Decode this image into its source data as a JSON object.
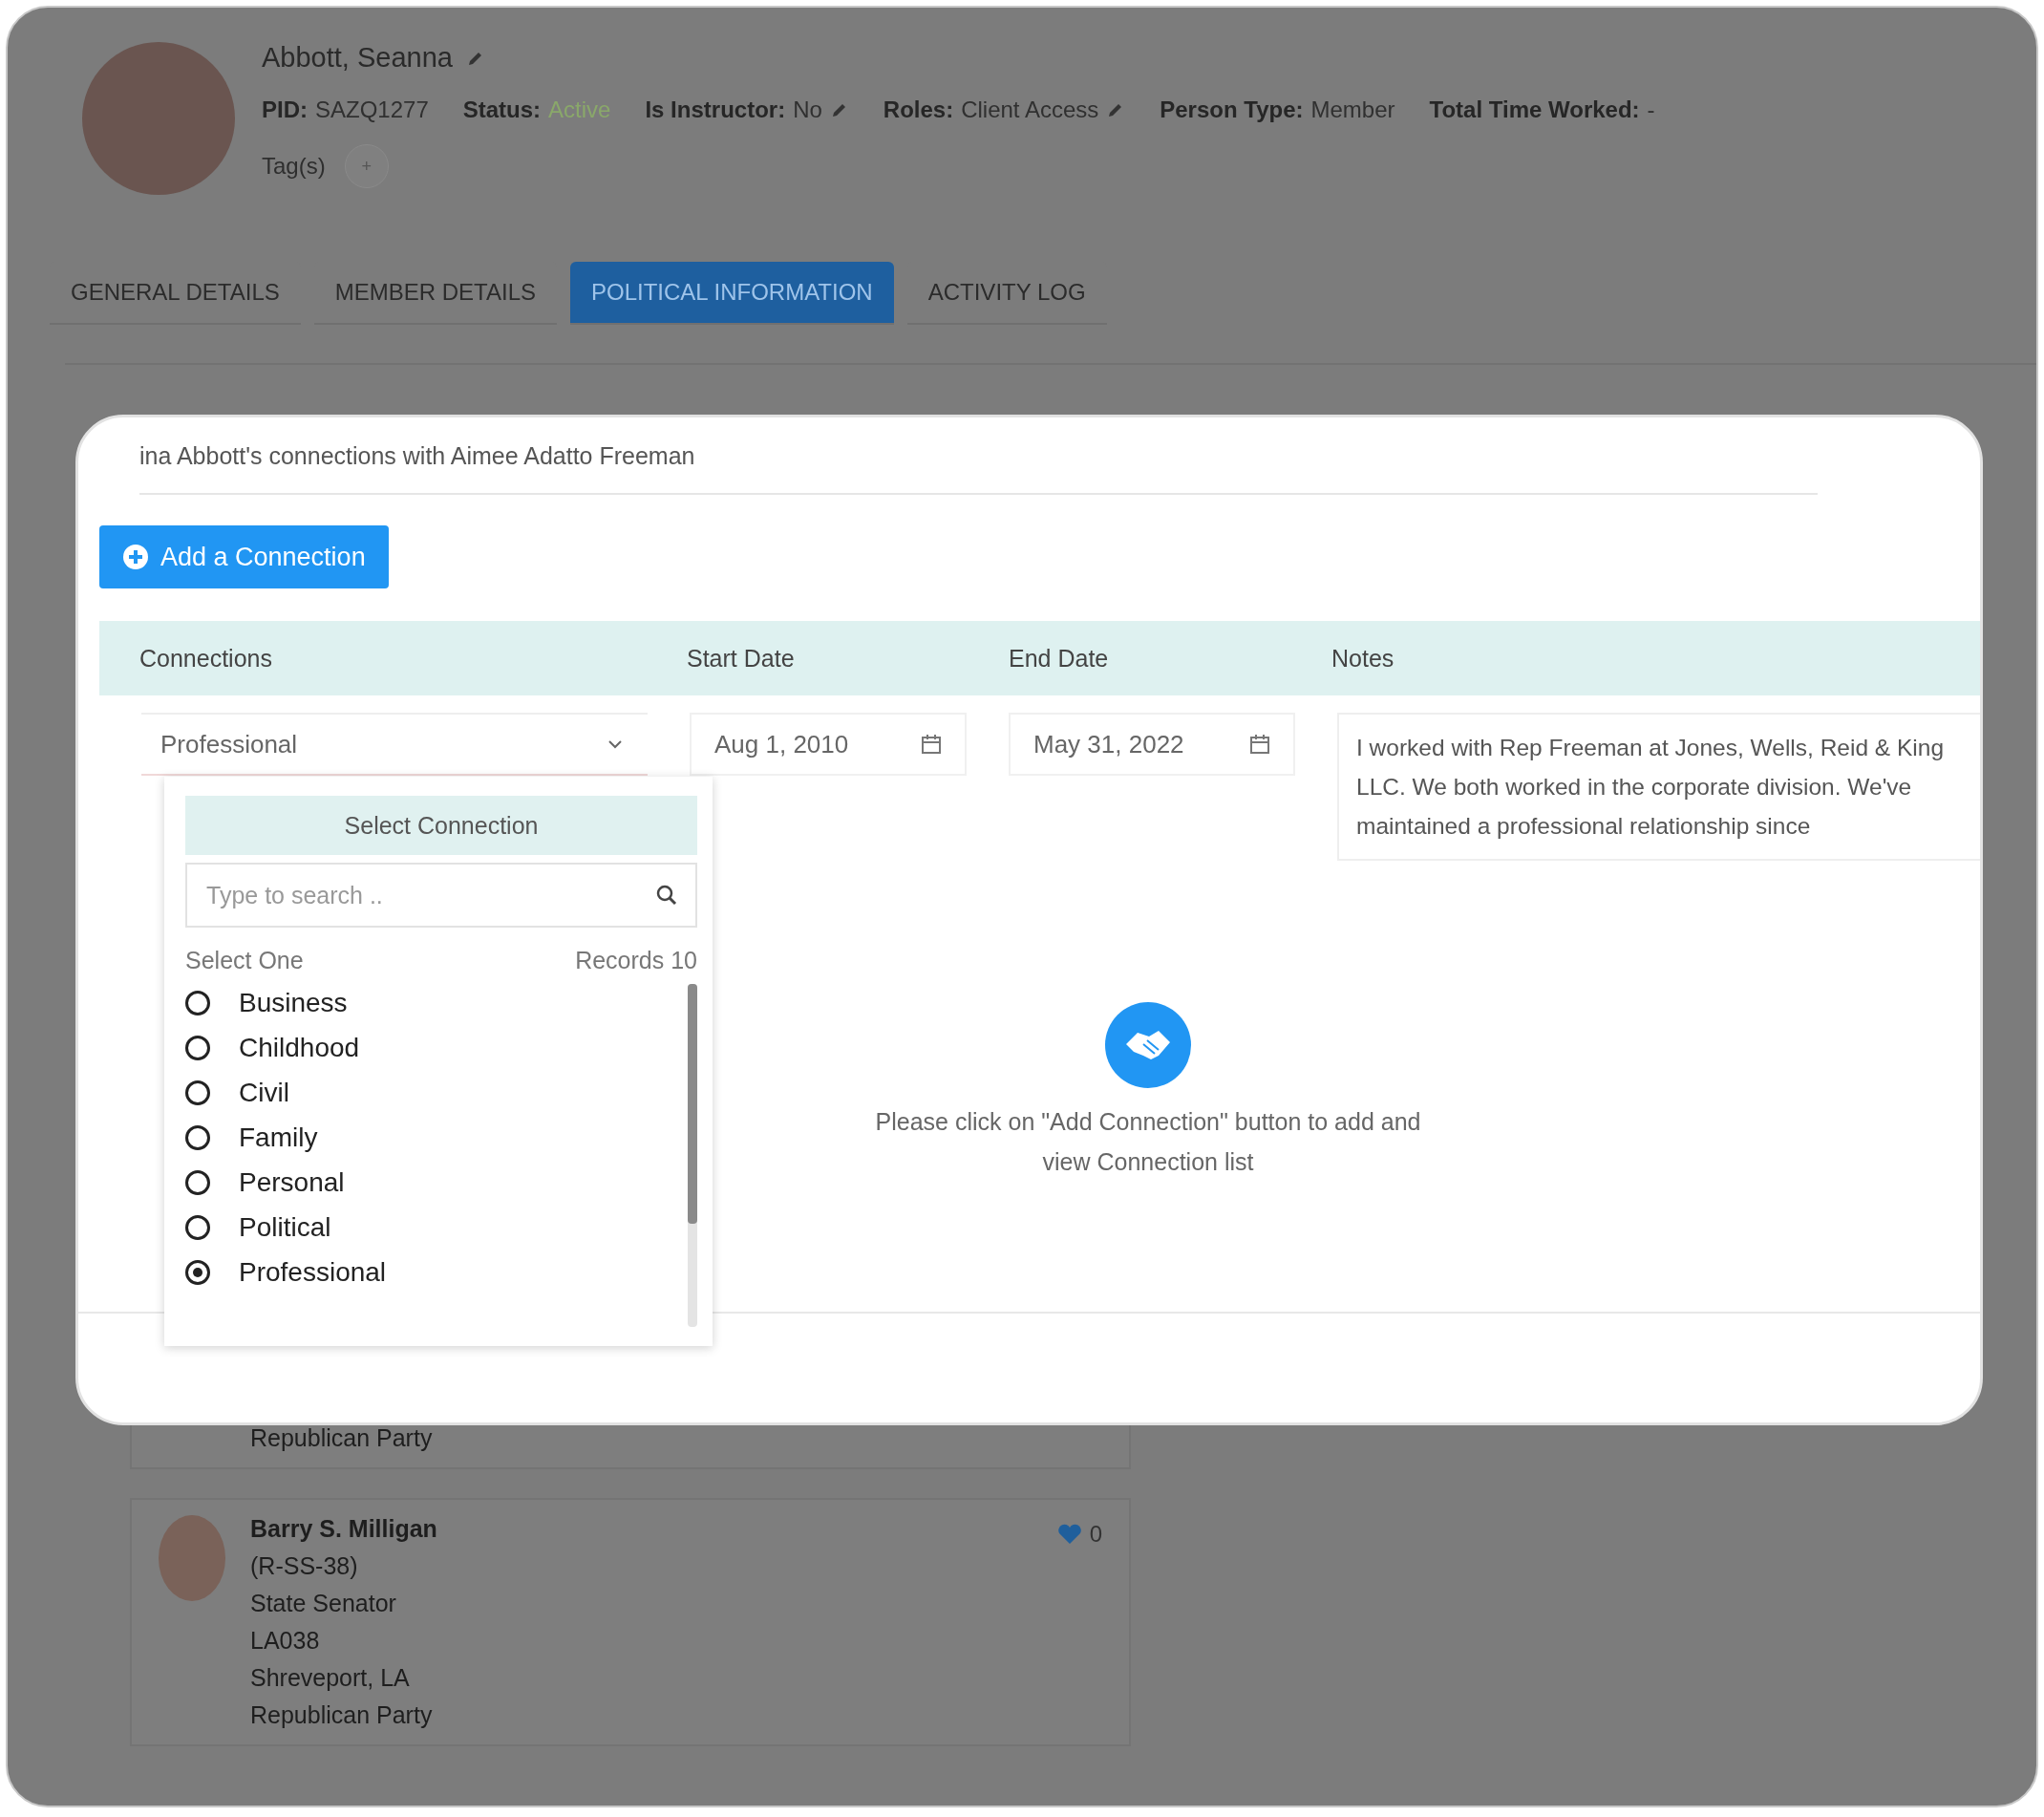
{
  "profile": {
    "name": "Abbott, Seanna",
    "name_editable": true,
    "fields": [
      {
        "label": "PID:",
        "value": "SAZQ1277",
        "kind": "text",
        "editable": false
      },
      {
        "label": "Status:",
        "value": "Active",
        "kind": "status",
        "editable": false
      },
      {
        "label": "Is Instructor:",
        "value": "No",
        "kind": "text",
        "editable": true
      },
      {
        "label": "Roles:",
        "value": "Client Access",
        "kind": "text",
        "editable": true
      },
      {
        "label": "Person Type:",
        "value": "Member",
        "kind": "text",
        "editable": false
      },
      {
        "label": "Total Time Worked:",
        "value": "-",
        "kind": "text",
        "editable": false
      }
    ],
    "tags_label": "Tag(s)",
    "tag_add": "+"
  },
  "tabs": [
    {
      "label": "GENERAL DETAILS",
      "selected": false
    },
    {
      "label": "MEMBER DETAILS",
      "selected": false
    },
    {
      "label": "POLITICAL INFORMATION",
      "selected": true
    },
    {
      "label": "ACTIVITY LOG",
      "selected": false
    }
  ],
  "modal": {
    "title": "ina Abbott's connections with Aimee Adatto Freeman",
    "add_button": "Add a Connection",
    "columns": [
      "Connections",
      "Start Date",
      "End Date",
      "Notes"
    ],
    "row": {
      "connection": "Professional",
      "start_date": "Aug 1, 2010",
      "end_date": "May 31, 2022",
      "notes": "I worked with Rep Freeman at Jones, Wells, Reid & King LLC. We both worked in the corporate division. We've maintained a professional relationship since"
    },
    "dropdown": {
      "header": "Select Connection",
      "search_placeholder": "Type to search ..",
      "select_label": "Select One",
      "records": "Records 10",
      "options": [
        {
          "label": "Business",
          "selected": false
        },
        {
          "label": "Childhood",
          "selected": false
        },
        {
          "label": "Civil",
          "selected": false
        },
        {
          "label": "Family",
          "selected": false
        },
        {
          "label": "Personal",
          "selected": false
        },
        {
          "label": "Political",
          "selected": false
        },
        {
          "label": "Professional",
          "selected": true
        }
      ]
    },
    "empty_message": "Please click on \"Add Connection\" button to add and view Connection list"
  },
  "cards": [
    {
      "lines": [
        "Republican Party"
      ]
    },
    {
      "name": "Barry S. Milligan",
      "lines": [
        "(R-SS-38)",
        "State Senator",
        "LA038",
        "Shreveport, LA",
        "Republican Party"
      ],
      "likes": "0"
    }
  ]
}
